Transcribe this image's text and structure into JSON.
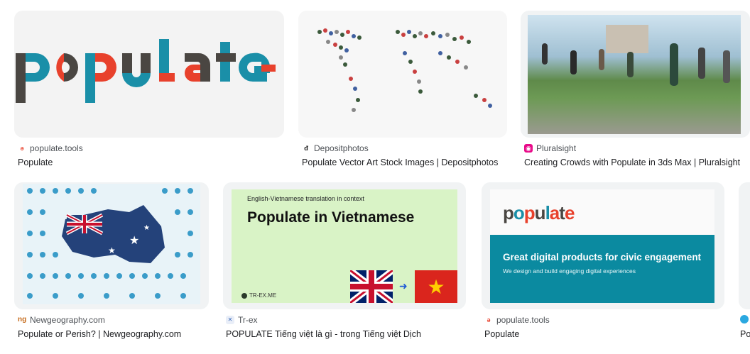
{
  "results": [
    {
      "source": "populate.tools",
      "title": "Populate",
      "favicon": "populate-favicon",
      "logo_text": "populate"
    },
    {
      "source": "Depositphotos",
      "title": "Populate Vector Art Stock Images | Depositphotos",
      "favicon": "depositphotos-favicon"
    },
    {
      "source": "Pluralsight",
      "title": "Creating Crowds with Populate in 3ds Max | Pluralsight",
      "favicon": "pluralsight-favicon"
    },
    {
      "source": "Newgeography.com",
      "title": "Populate or Perish? | Newgeography.com",
      "favicon": "newgeography-favicon"
    },
    {
      "source": "Tr-ex",
      "title": "POPULATE Tiếng việt là gì - trong Tiếng việt Dịch",
      "favicon": "trex-favicon",
      "image_small": "English-Vietnamese translation in context",
      "image_heading": "Populate in Vietnamese",
      "image_footer": "TR-EX.ME"
    },
    {
      "source": "populate.tools",
      "title": "Populate",
      "favicon": "populate-favicon",
      "logo_text": "populate",
      "image_heading": "Great digital products for civic engagement",
      "image_sub": "We design and build engaging digital experiences"
    },
    {
      "source": "",
      "title": "Po",
      "favicon": "generic-favicon"
    }
  ],
  "colors": {
    "populate_red": "#e8412c",
    "populate_teal": "#1a8fa8",
    "populate_gray": "#4a4642",
    "trex_green": "#d9f3c6",
    "populate_band": "#0b8aa0"
  }
}
